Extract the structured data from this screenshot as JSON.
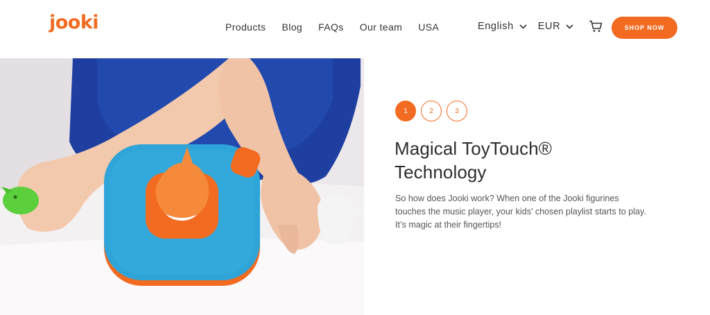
{
  "header": {
    "logo": "jooki",
    "nav": [
      "Products",
      "Blog",
      "FAQs",
      "Our team",
      "USA"
    ],
    "language": "English",
    "currency": "EUR",
    "cart_icon": "cart-icon",
    "shop_button": "SHOP NOW"
  },
  "hero": {
    "image_alt": "Child's hands placing an orange figurine on a blue Jooki music player",
    "steps": [
      "1",
      "2",
      "3"
    ],
    "active_step": "1",
    "title_line1": "Magical ToyTouch®",
    "title_line2": "Technology",
    "description": "So how does Jooki work? When one of the Jooki figurines touches the music player, your kids’ chosen playlist starts to play. It’s magic at their fingertips!"
  },
  "colors": {
    "accent": "#f26b21",
    "player_blue": "#2fa4d8",
    "text": "#333333"
  }
}
